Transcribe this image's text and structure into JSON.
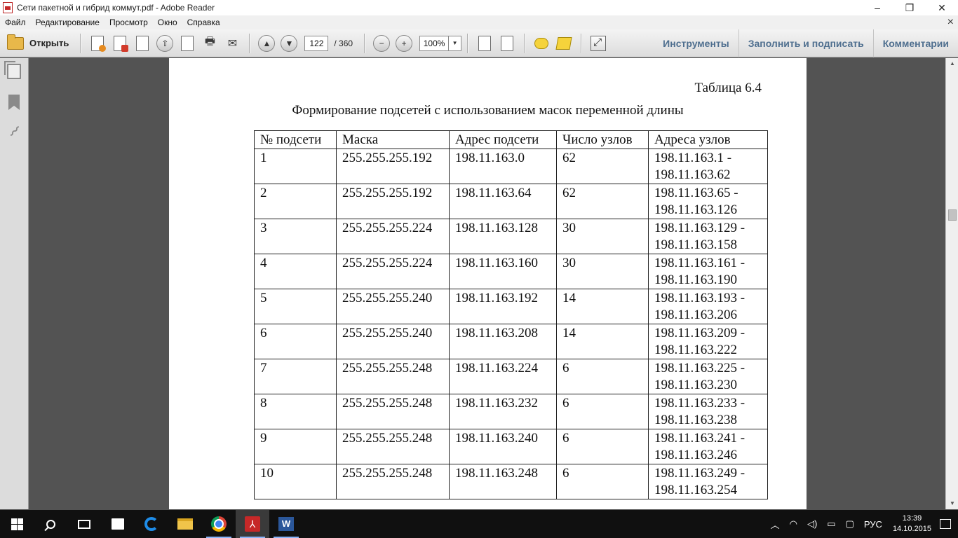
{
  "window": {
    "title": "Сети пакетной и гибрид коммут.pdf - Adobe Reader",
    "minimize": "–",
    "maximize": "❐",
    "close": "✕"
  },
  "menu": [
    "Файл",
    "Редактирование",
    "Просмотр",
    "Окно",
    "Справка"
  ],
  "menu_close": "×",
  "toolbar": {
    "open_label": "Открыть",
    "page_current": "122",
    "page_total": "/ 360",
    "zoom": "100%",
    "tools_label": "Инструменты",
    "fill_sign_label": "Заполнить и подписать",
    "comments_label": "Комментарии"
  },
  "document": {
    "table_label": "Таблица 6.4",
    "table_caption": "Формирование подсетей с использованием масок переменной длины",
    "headers": [
      "№ подсети",
      "Маска",
      "Адрес подсети",
      "Число узлов",
      "Адреса узлов"
    ],
    "rows": [
      [
        "1",
        "255.255.255.192",
        "198.11.163.0",
        "62",
        "198.11.163.1 -",
        "198.11.163.62"
      ],
      [
        "2",
        "255.255.255.192",
        "198.11.163.64",
        "62",
        "198.11.163.65 -",
        "198.11.163.126"
      ],
      [
        "3",
        "255.255.255.224",
        "198.11.163.128",
        "30",
        "198.11.163.129 -",
        "198.11.163.158"
      ],
      [
        "4",
        "255.255.255.224",
        "198.11.163.160",
        "30",
        "198.11.163.161 -",
        "198.11.163.190"
      ],
      [
        "5",
        "255.255.255.240",
        "198.11.163.192",
        "14",
        "198.11.163.193 -",
        "198.11.163.206"
      ],
      [
        "6",
        "255.255.255.240",
        "198.11.163.208",
        "14",
        "198.11.163.209 -",
        "198.11.163.222"
      ],
      [
        "7",
        "255.255.255.248",
        "198.11.163.224",
        "6",
        "198.11.163.225 -",
        "198.11.163.230"
      ],
      [
        "8",
        "255.255.255.248",
        "198.11.163.232",
        "6",
        "198.11.163.233 -",
        "198.11.163.238"
      ],
      [
        "9",
        "255.255.255.248",
        "198.11.163.240",
        "6",
        "198.11.163.241 -",
        "198.11.163.246"
      ],
      [
        "10",
        "255.255.255.248",
        "198.11.163.248",
        "6",
        "198.11.163.249 -",
        "198.11.163.254"
      ]
    ]
  },
  "taskbar": {
    "language": "РУС",
    "time": "13:39",
    "date": "14.10.2015"
  },
  "icons": {
    "acrobat_glyph": "⅄",
    "word_glyph": "W"
  }
}
